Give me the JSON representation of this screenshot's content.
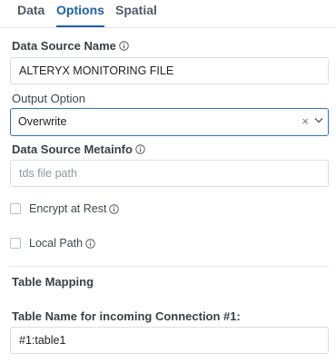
{
  "tabs": [
    {
      "label": "Data",
      "active": false
    },
    {
      "label": "Options",
      "active": true
    },
    {
      "label": "Spatial",
      "active": false
    }
  ],
  "data_source_name": {
    "label": "Data Source Name",
    "value": "ALTERYX MONITORING FILE"
  },
  "output_option": {
    "label": "Output Option",
    "selected": "Overwrite",
    "clear_glyph": "×"
  },
  "data_source_metainfo": {
    "label": "Data Source Metainfo",
    "placeholder": "tds file path",
    "value": ""
  },
  "encrypt_at_rest": {
    "label": "Encrypt at Rest",
    "checked": false
  },
  "local_path": {
    "label": "Local Path",
    "checked": false
  },
  "table_mapping": {
    "heading": "Table Mapping"
  },
  "table_name": {
    "label": "Table Name for incoming Connection #1:",
    "value": "#1:table1"
  },
  "colors": {
    "accent": "#1f5fb0",
    "focus_border": "#2f73cf",
    "border": "#d9dde4"
  },
  "icons": {
    "info": "info-circle-icon",
    "chevron": "chevron-down-icon",
    "clear": "clear-x-icon"
  }
}
